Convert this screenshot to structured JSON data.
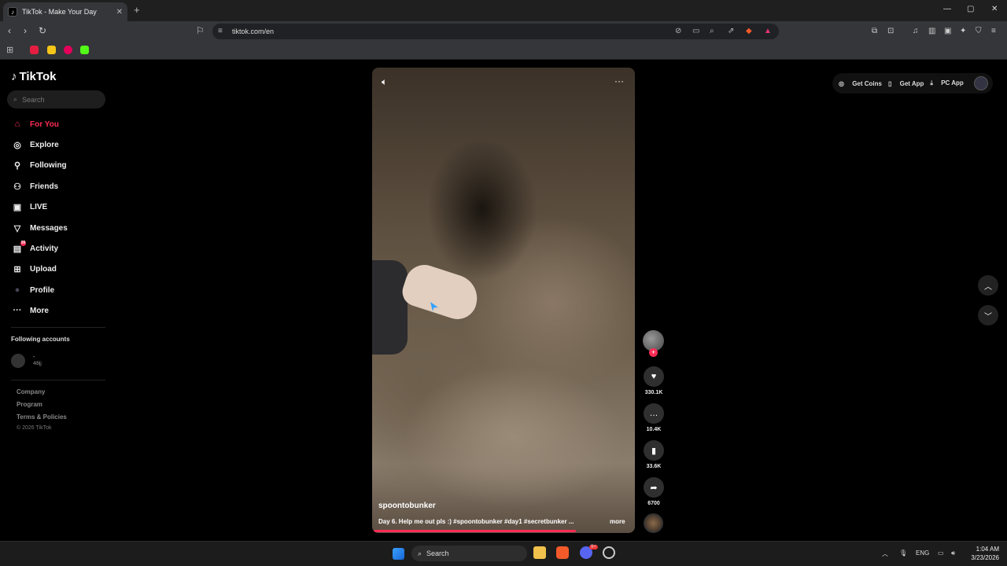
{
  "browser": {
    "tab_title": "TikTok - Make Your Day",
    "tab_close": "✕",
    "new_tab": "+",
    "url": "tiktok.com/en",
    "window_controls": {
      "minimize": "—",
      "maximize": "▢",
      "close": "✕"
    }
  },
  "sidebar": {
    "logo": "TikTok",
    "search_placeholder": "Search",
    "items": [
      {
        "label": "For You",
        "icon": "home-icon",
        "glyph": "⌂",
        "active": true
      },
      {
        "label": "Explore",
        "icon": "compass-icon",
        "glyph": "◎"
      },
      {
        "label": "Following",
        "icon": "person-plus-icon",
        "glyph": "⚲"
      },
      {
        "label": "Friends",
        "icon": "friends-icon",
        "glyph": "⚇"
      },
      {
        "label": "LIVE",
        "icon": "live-tv-icon",
        "glyph": "▣"
      },
      {
        "label": "Messages",
        "icon": "send-icon",
        "glyph": "▽"
      },
      {
        "label": "Activity",
        "icon": "activity-icon",
        "glyph": "▤",
        "badge": "99"
      },
      {
        "label": "Upload",
        "icon": "plus-square-icon",
        "glyph": "⊞"
      },
      {
        "label": "Profile",
        "icon": "profile-avatar-icon",
        "glyph": "●"
      },
      {
        "label": "More",
        "icon": "more-dots-icon",
        "glyph": "···"
      }
    ],
    "following_title": "Following accounts",
    "following_accounts": [
      {
        "name": "-",
        "handle": "4l9jj"
      }
    ],
    "footer_links": [
      "Company",
      "Program",
      "Terms & Policies"
    ],
    "copyright": "© 2026 TikTok"
  },
  "video": {
    "username": "spoontobunker",
    "caption": "Day 6. Help me out pls :) #spoontobunker #day1 #secretbunker ...",
    "more_label": "more",
    "progress": 0.78
  },
  "actions": {
    "likes": "330.1K",
    "comments": "10.4K",
    "saves": "33.6K",
    "shares": "6700"
  },
  "header_right": {
    "get_coins": "Get Coins",
    "get_app": "Get App",
    "pc_app": "PC App"
  },
  "taskbar": {
    "search": "Search",
    "lang": "ENG",
    "time": "1:04 AM",
    "date": "3/23/2026",
    "discord_badge": "9+"
  }
}
